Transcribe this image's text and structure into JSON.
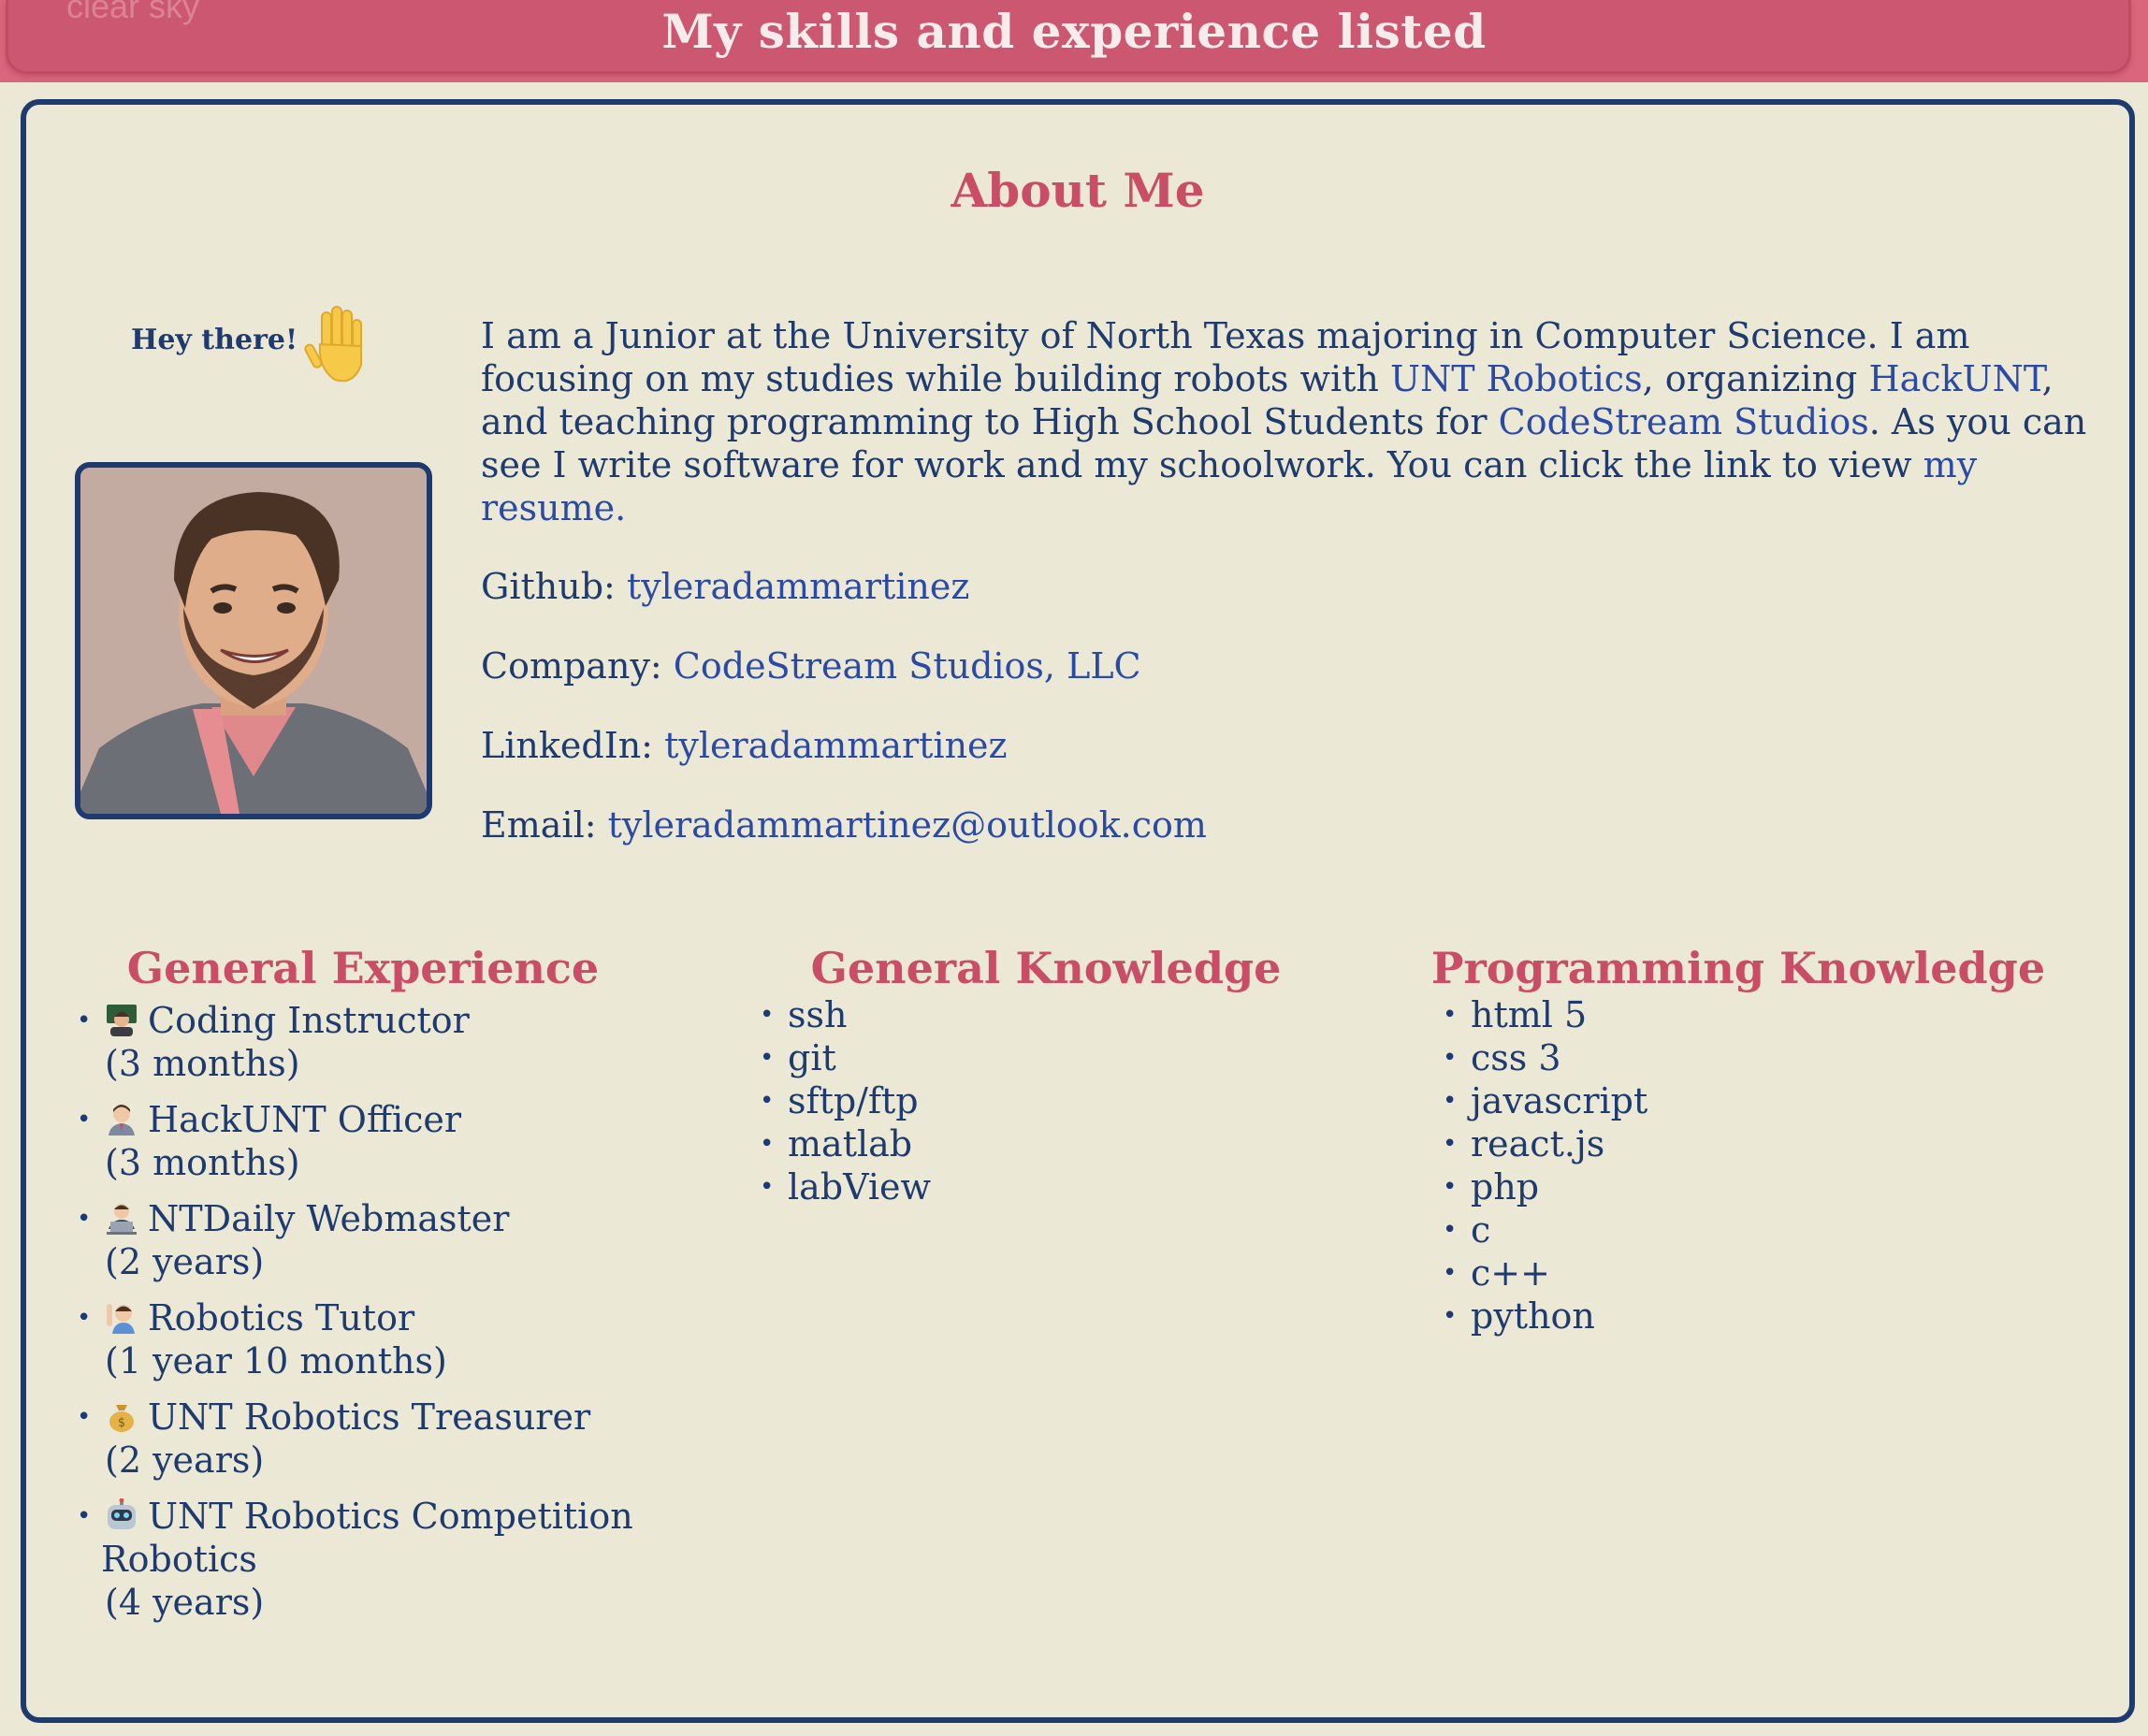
{
  "header": {
    "ghost_text": "clear sky",
    "title": "My skills and experience listed"
  },
  "about": {
    "title": "About Me",
    "greeting": "Hey there!",
    "bio": {
      "t1": "I am a Junior at the University of North Texas majoring in Computer Science. I am focusing on my studies while building robots with ",
      "l1": "UNT Robotics",
      "t2": ", organizing ",
      "l2": "HackUNT",
      "t3": ", and teaching programming to High School Students for ",
      "l3": "CodeStream Studios",
      "t4": ". As you can see I write software for work and my schoolwork. You can click the link to view ",
      "l4": "my resume."
    },
    "contacts": [
      {
        "label": "Github: ",
        "value": "tyleradammartinez"
      },
      {
        "label": "Company: ",
        "value": "CodeStream Studios, LLC"
      },
      {
        "label": "LinkedIn: ",
        "value": "tyleradammartinez"
      },
      {
        "label": "Email: ",
        "value": "tyleradammartinez@outlook.com"
      }
    ]
  },
  "experience": {
    "title": "General Experience",
    "items": [
      {
        "icon": "teacher-emoji-icon",
        "role": "Coding Instructor",
        "duration": "(3 months)"
      },
      {
        "icon": "office-worker-emoji-icon",
        "role": "HackUNT Officer",
        "duration": "(3 months)"
      },
      {
        "icon": "technologist-emoji-icon",
        "role": "NTDaily Webmaster",
        "duration": "(2 years)"
      },
      {
        "icon": "raising-hand-emoji-icon",
        "role": "Robotics Tutor",
        "duration": "(1 year 10 months)"
      },
      {
        "icon": "money-bag-emoji-icon",
        "role": "UNT Robotics Treasurer",
        "duration": "(2 years)"
      },
      {
        "icon": "robot-emoji-icon",
        "role": "UNT Robotics Competition",
        "role2": "Robotics",
        "duration": "(4 years)"
      }
    ]
  },
  "general_knowledge": {
    "title": "General Knowledge",
    "items": [
      "ssh",
      "git",
      "sftp/ftp",
      "matlab",
      "labView"
    ]
  },
  "programming_knowledge": {
    "title": "Programming Knowledge",
    "items": [
      "html 5",
      "css 3",
      "javascript",
      "react.js",
      "php",
      "c",
      "c++",
      "python"
    ]
  },
  "colors": {
    "header_bg": "#cc5770",
    "page_bg": "#ebe9d6",
    "accent_red": "#c94d66",
    "navy": "#1e3a6e",
    "link": "#2a4aa6"
  }
}
